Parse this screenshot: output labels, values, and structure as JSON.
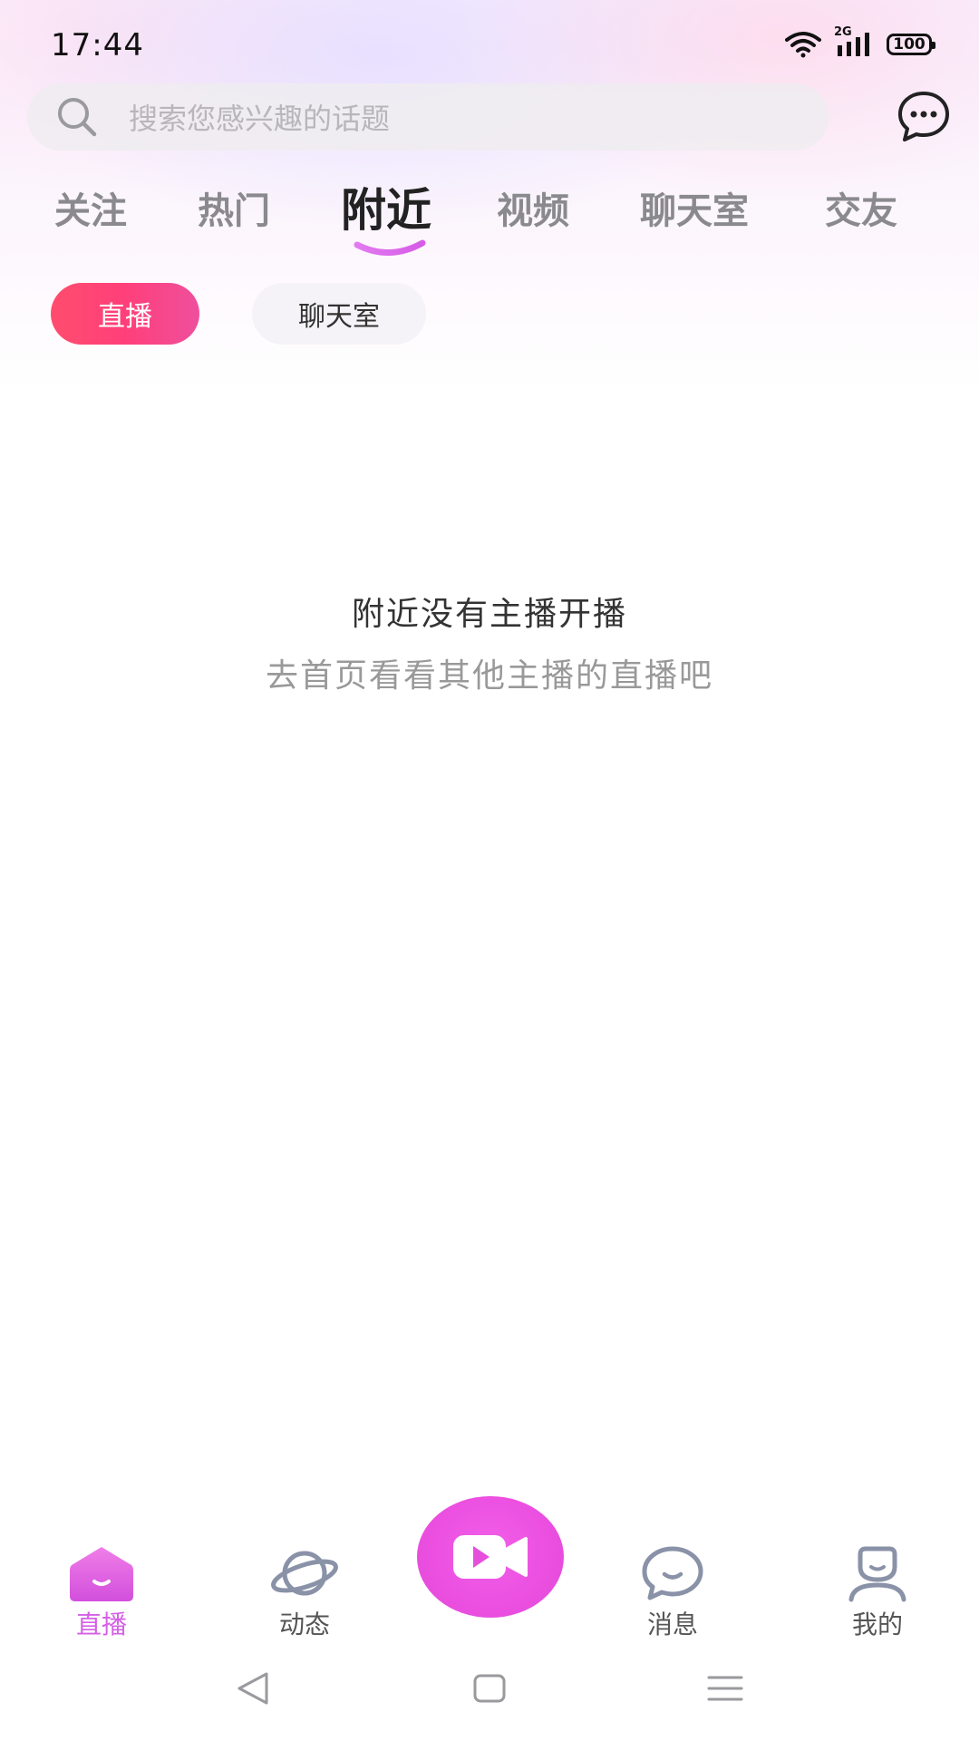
{
  "status_bar": {
    "time": "17:44",
    "network": "2G",
    "battery": "100"
  },
  "search": {
    "placeholder": "搜索您感兴趣的话题"
  },
  "tabs": [
    {
      "label": "关注"
    },
    {
      "label": "热门"
    },
    {
      "label": "附近"
    },
    {
      "label": "视频"
    },
    {
      "label": "聊天室"
    },
    {
      "label": "交友"
    }
  ],
  "active_tab": "附近",
  "subtabs": [
    {
      "label": "直播"
    },
    {
      "label": "聊天室"
    }
  ],
  "empty_state": {
    "title": "附近没有主播开播",
    "subtitle": "去首页看看其他主播的直播吧"
  },
  "bottom_nav": [
    {
      "label": "直播",
      "icon": "live-home-icon"
    },
    {
      "label": "动态",
      "icon": "planet-icon"
    },
    {
      "label": "",
      "icon": "video-camera-icon"
    },
    {
      "label": "消息",
      "icon": "message-bubble-icon"
    },
    {
      "label": "我的",
      "icon": "profile-icon"
    }
  ],
  "colors": {
    "accent": "#e74fdc",
    "active_pill": "#ff4d6d",
    "active_nav": "#d55fe6"
  }
}
